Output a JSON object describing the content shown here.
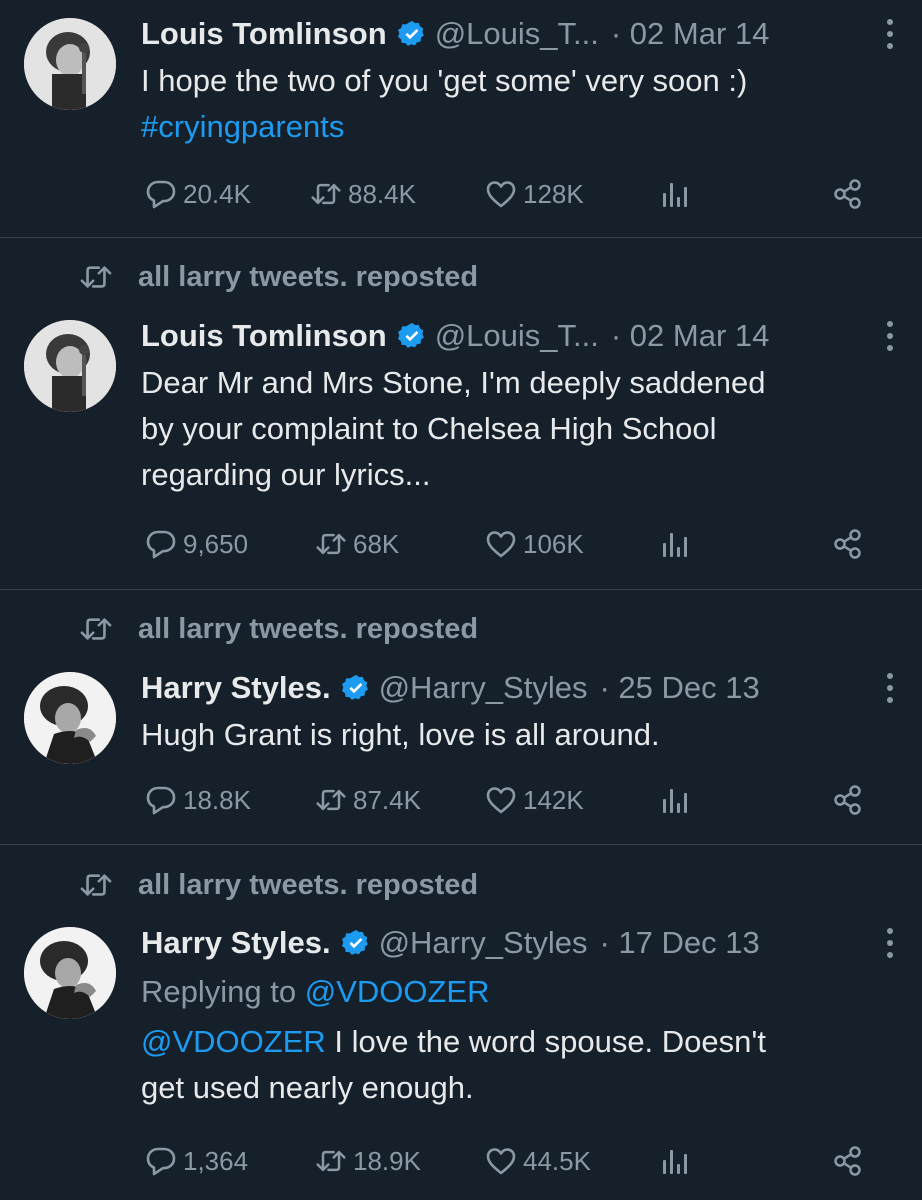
{
  "colors": {
    "background": "#15202b",
    "text": "#e7e9ea",
    "muted": "#8b98a5",
    "link": "#1d9bf0",
    "divider": "#38444d"
  },
  "tweets": [
    {
      "reposted_by": "",
      "name": "Louis Tomlinson",
      "handle": "@Louis_T...",
      "date": "· 02 Mar 14",
      "replying_prefix": "",
      "replying_to": "",
      "mention": "",
      "text_line1": "I hope the two of you 'get some' very soon :)",
      "text_line2": "",
      "text_line3": "",
      "hashtag": "#cryingparents",
      "replies": "20.4K",
      "reposts": "88.4K",
      "likes": "128K",
      "avatar_icon": "louis-avatar"
    },
    {
      "reposted_by": "all larry tweets. reposted",
      "name": "Louis Tomlinson",
      "handle": "@Louis_T...",
      "date": "· 02 Mar 14",
      "text_line1": "Dear Mr and Mrs Stone, I'm deeply saddened",
      "text_line2": "by your complaint to Chelsea High School",
      "text_line3": "regarding our lyrics...",
      "replies": "9,650",
      "reposts": "68K",
      "likes": "106K",
      "avatar_icon": "louis-avatar"
    },
    {
      "reposted_by": "all larry tweets. reposted",
      "name": "Harry Styles.",
      "handle": "@Harry_Styles",
      "date": "· 25 Dec 13",
      "text_line1": "Hugh Grant is right, love is all around.",
      "replies": "18.8K",
      "reposts": "87.4K",
      "likes": "142K",
      "avatar_icon": "harry-avatar"
    },
    {
      "reposted_by": "all larry tweets. reposted",
      "name": "Harry Styles.",
      "handle": "@Harry_Styles",
      "date": "· 17 Dec 13",
      "replying_prefix": "Replying to",
      "replying_to": "@VDOOZER",
      "mention": "@VDOOZER",
      "text_line1": " I love the word spouse. Doesn't",
      "text_line2": "get used nearly enough.",
      "replies": "1,364",
      "reposts": "18.9K",
      "likes": "44.5K",
      "avatar_icon": "harry-avatar"
    }
  ]
}
